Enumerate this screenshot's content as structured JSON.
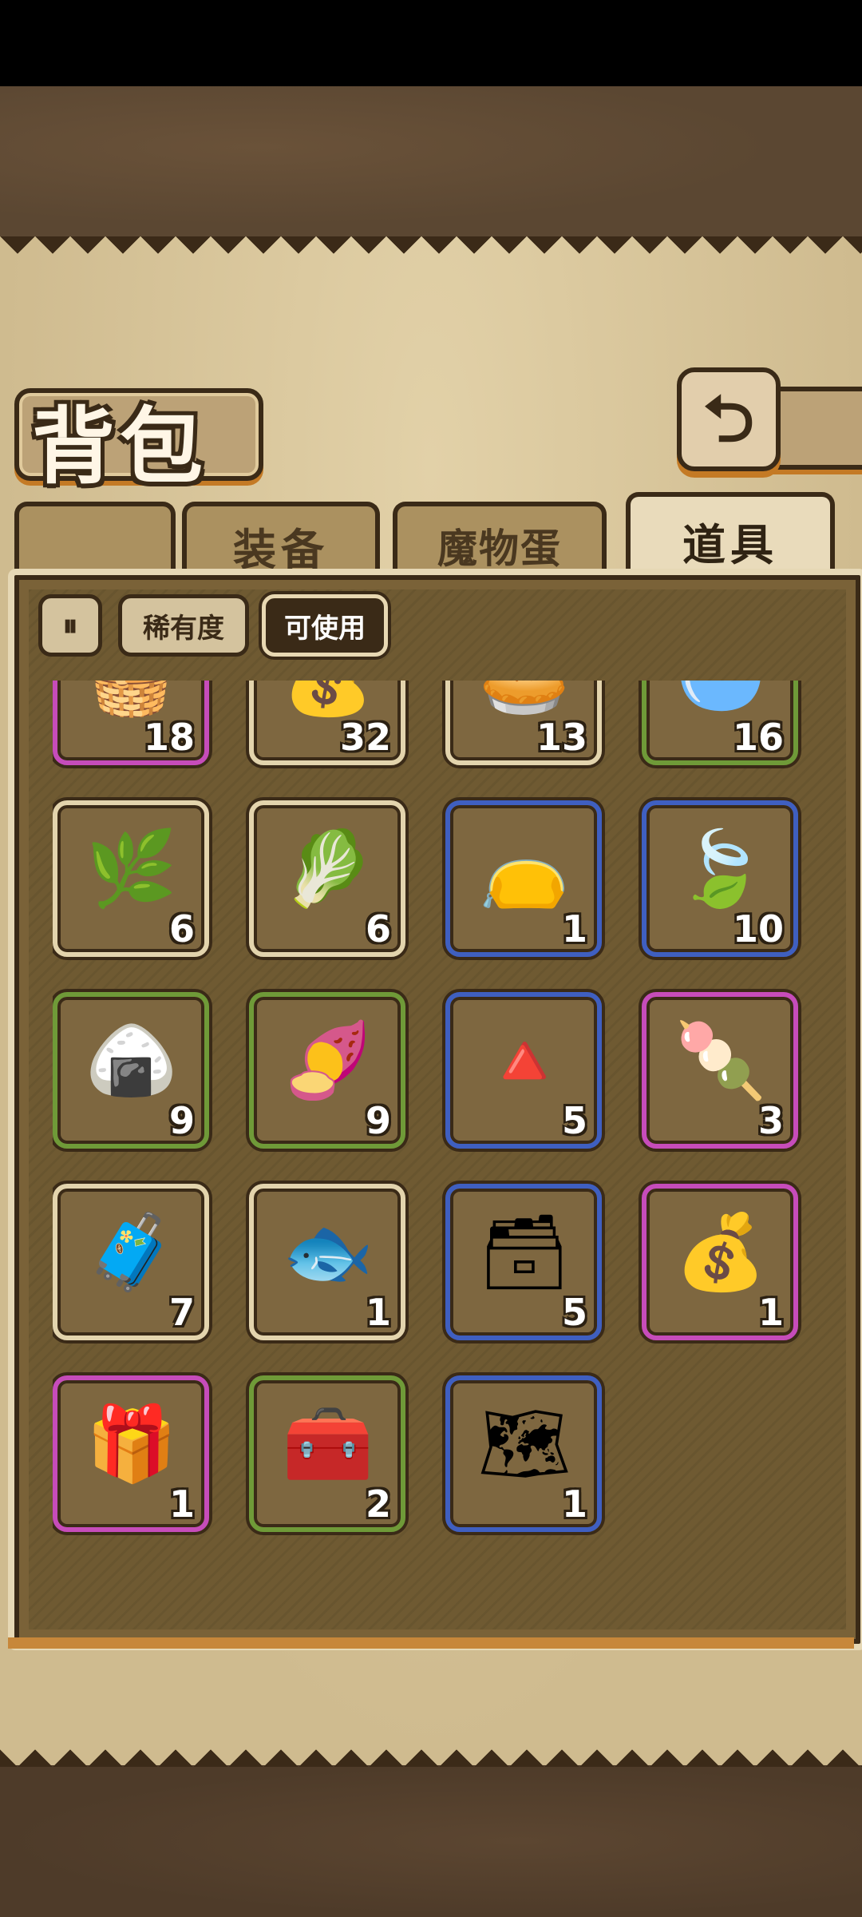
{
  "page": {
    "title": "背包"
  },
  "tabs": [
    {
      "label": "装备",
      "active": false
    },
    {
      "label": "魔物蛋",
      "active": false
    },
    {
      "label": "道具",
      "active": true
    }
  ],
  "filters": {
    "sort_icon": "sort-toggle-icon",
    "rarity_label": "稀有度",
    "usable_label": "可使用",
    "colors": [
      "#a8a08c",
      "#6e9a3a",
      "#3b86b5",
      "#c4408f",
      "#d6a21f"
    ]
  },
  "colors": {
    "green": "#6f9a38",
    "blue": "#3f5fc0",
    "pink": "#c64cba",
    "white": "#e3d4ad"
  },
  "items": [
    {
      "icon": "bread-basket-icon",
      "glyph": "🧺",
      "count": "18",
      "rarity": "pink"
    },
    {
      "icon": "coin-sack-icon",
      "glyph": "💰",
      "count": "32",
      "rarity": "white"
    },
    {
      "icon": "grill-net-icon",
      "glyph": "🥧",
      "count": "13",
      "rarity": "white"
    },
    {
      "icon": "water-bowl-icon",
      "glyph": "🥣",
      "count": "16",
      "rarity": "green"
    },
    {
      "icon": "seaweed-icon",
      "glyph": "🌿",
      "count": "6",
      "rarity": "white"
    },
    {
      "icon": "radish-icon",
      "glyph": "🥬",
      "count": "6",
      "rarity": "white"
    },
    {
      "icon": "swirl-sack-icon",
      "glyph": "👝",
      "count": "1",
      "rarity": "blue"
    },
    {
      "icon": "herb-leaf-icon",
      "glyph": "🍃",
      "count": "10",
      "rarity": "blue"
    },
    {
      "icon": "rice-dumpling-white-icon",
      "glyph": "🍙",
      "count": "9",
      "rarity": "green"
    },
    {
      "icon": "rice-dumpling-brown-icon",
      "glyph": "🍠",
      "count": "9",
      "rarity": "green"
    },
    {
      "icon": "rice-dumpling-green-icon",
      "glyph": "🔺",
      "count": "5",
      "rarity": "blue"
    },
    {
      "icon": "rainbow-popsicle-icon",
      "glyph": "🍡",
      "count": "3",
      "rarity": "pink"
    },
    {
      "icon": "wooden-chest-icon",
      "glyph": "🧳",
      "count": "7",
      "rarity": "white"
    },
    {
      "icon": "fish-icon",
      "glyph": "🐟",
      "count": "1",
      "rarity": "white"
    },
    {
      "icon": "blue-chest-icon",
      "glyph": "🗃",
      "count": "5",
      "rarity": "blue"
    },
    {
      "icon": "treasure-sack-icon",
      "glyph": "💰",
      "count": "1",
      "rarity": "pink"
    },
    {
      "icon": "red-chest-icon",
      "glyph": "🎁",
      "count": "1",
      "rarity": "pink"
    },
    {
      "icon": "gold-trim-chest-icon",
      "glyph": "🧰",
      "count": "2",
      "rarity": "green"
    },
    {
      "icon": "map-chest-icon",
      "glyph": "🗺",
      "count": "1",
      "rarity": "blue"
    }
  ]
}
